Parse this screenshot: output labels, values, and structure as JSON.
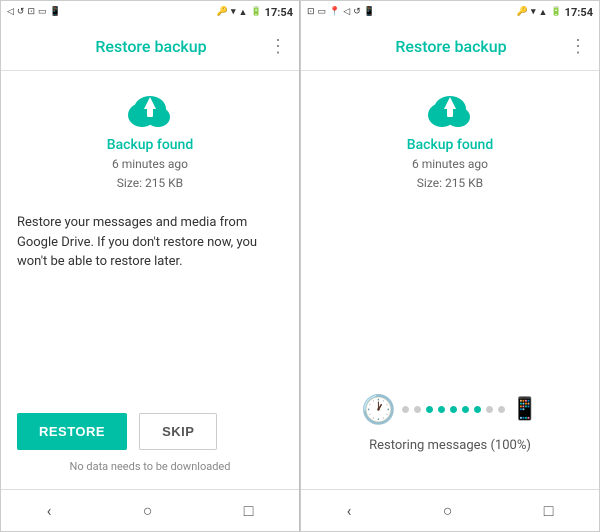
{
  "phone1": {
    "status_bar": {
      "time": "17:54",
      "icons_left": [
        "←",
        "↺",
        "⊡",
        "▭",
        "📱"
      ],
      "icons_right": [
        "🔑",
        "▼",
        "📶",
        "🔋"
      ]
    },
    "app_bar": {
      "title": "Restore backup",
      "menu_icon": "⋮"
    },
    "backup_found_label": "Backup found",
    "backup_time": "6 minutes ago",
    "backup_size": "Size: 215 KB",
    "description": "Restore your messages and media from Google Drive. If you don't restore now, you won't be able to restore later.",
    "restore_button_label": "RESTORE",
    "skip_button_label": "SKIP",
    "no_download_text": "No data needs to be downloaded",
    "nav": {
      "back": "‹",
      "home": "○",
      "recent": "□"
    }
  },
  "phone2": {
    "status_bar": {
      "time": "17:54",
      "icons_left": [
        "⊡",
        "▭",
        "📍",
        "←",
        "↺",
        "📱"
      ],
      "icons_right": [
        "🔑",
        "▼",
        "📶",
        "🔋"
      ]
    },
    "app_bar": {
      "title": "Restore backup",
      "menu_icon": "⋮"
    },
    "backup_found_label": "Backup found",
    "backup_time": "6 minutes ago",
    "backup_size": "Size: 215 KB",
    "progress": {
      "dots": [
        {
          "color": "gray"
        },
        {
          "color": "gray"
        },
        {
          "color": "green"
        },
        {
          "color": "green"
        },
        {
          "color": "green"
        },
        {
          "color": "green"
        },
        {
          "color": "green"
        },
        {
          "color": "gray"
        },
        {
          "color": "gray"
        }
      ],
      "status_text": "Restoring messages (100%)"
    },
    "nav": {
      "back": "‹",
      "home": "○",
      "recent": "□"
    }
  }
}
